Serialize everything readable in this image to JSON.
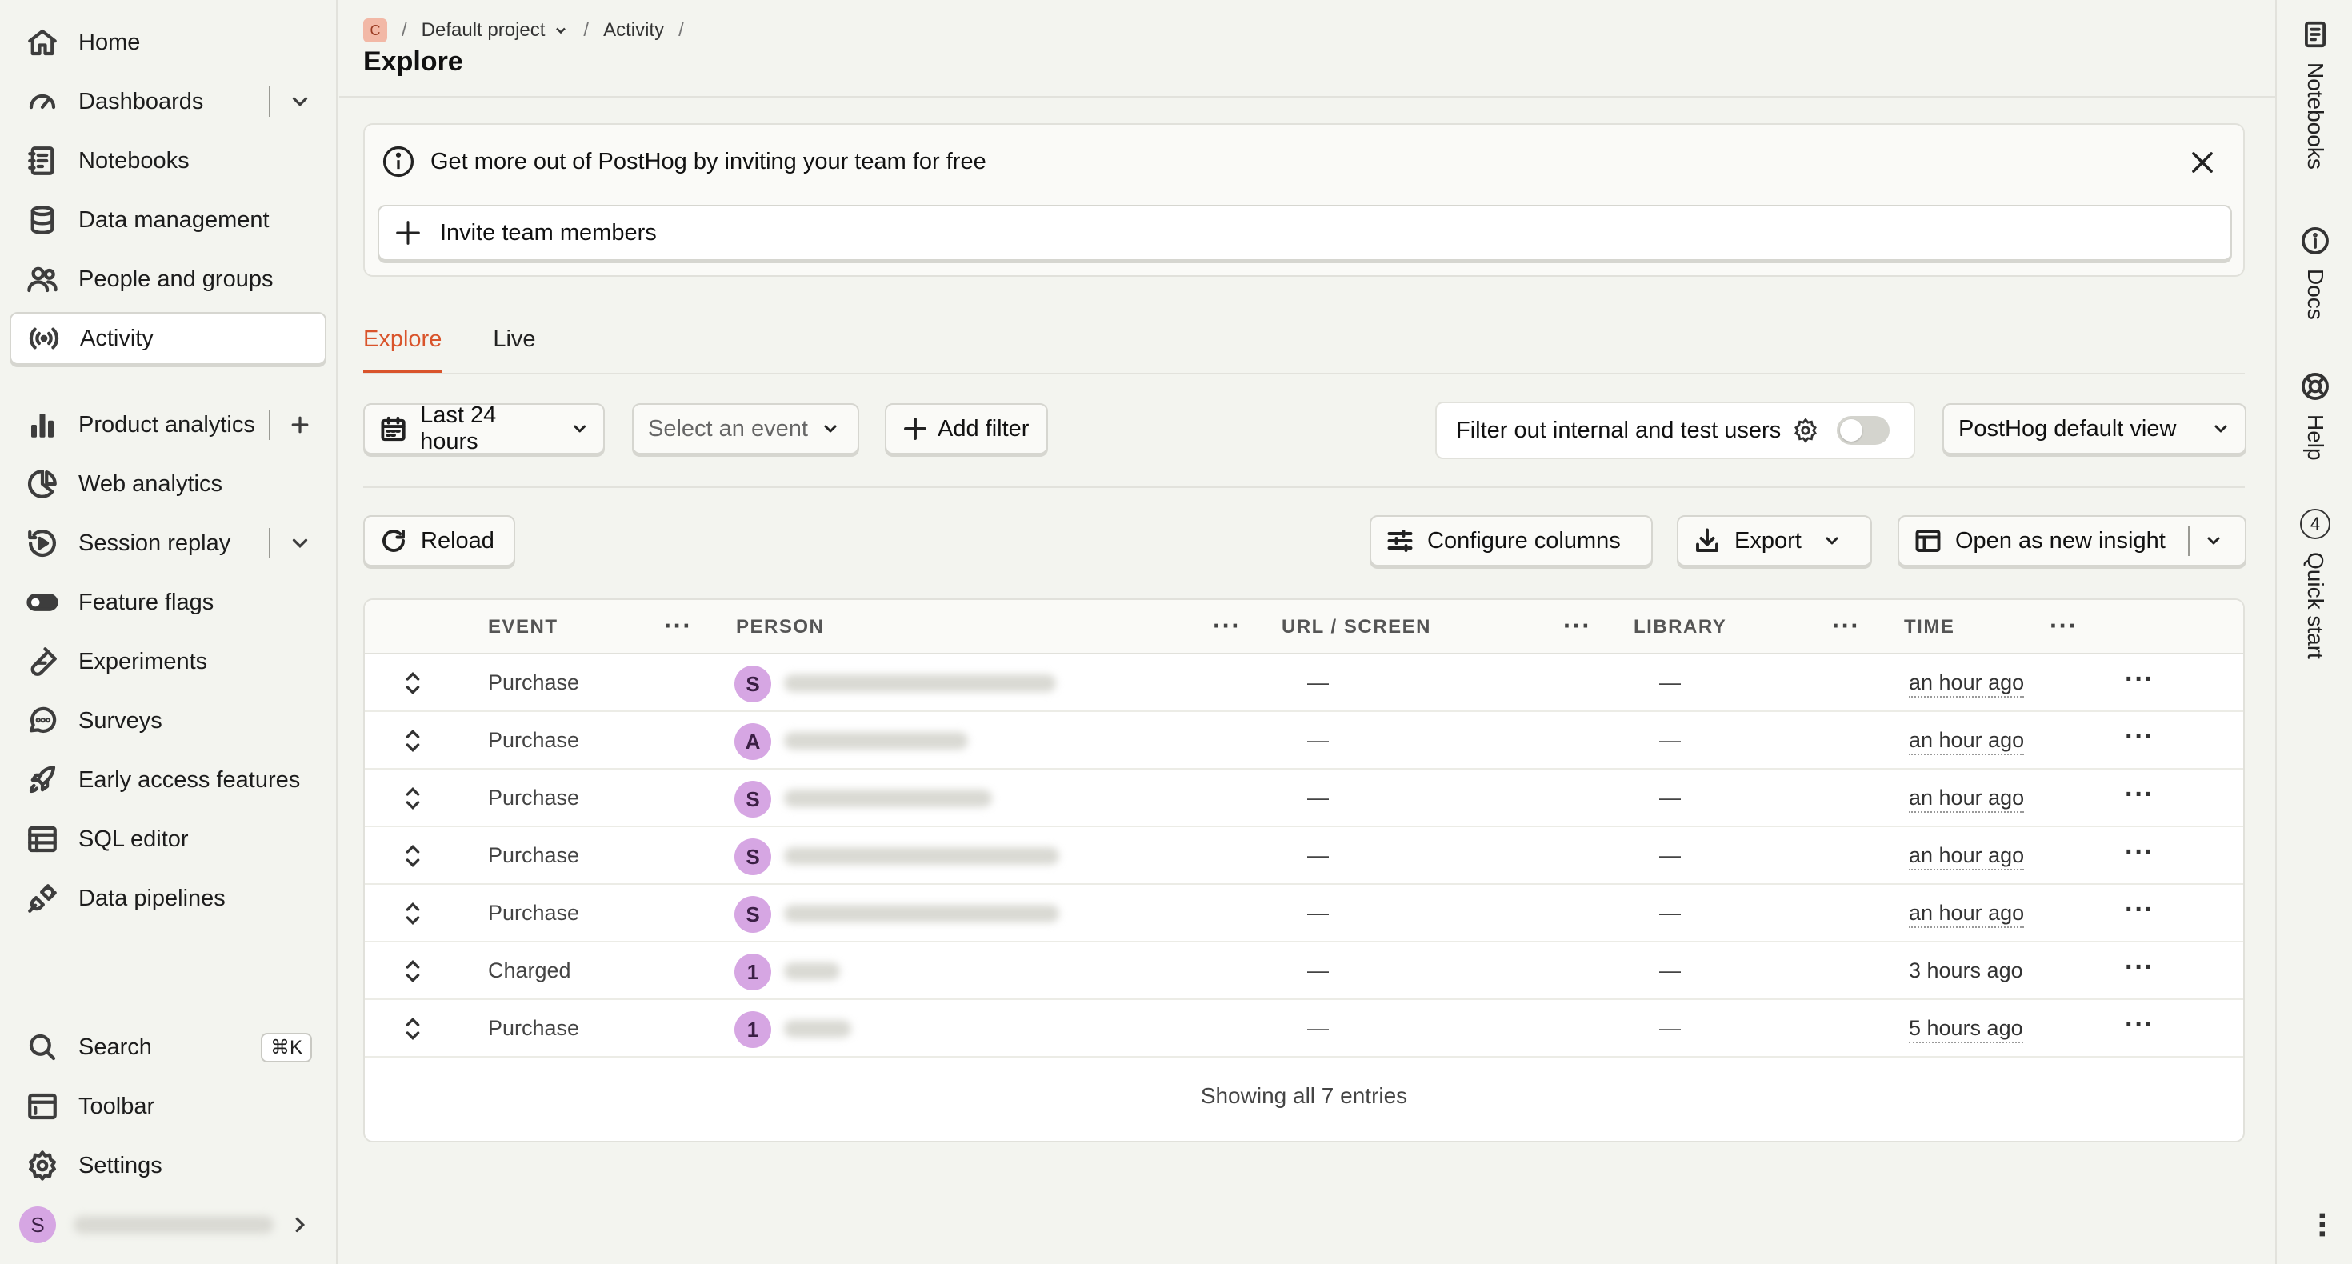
{
  "sidebar": {
    "items": [
      {
        "label": "Home"
      },
      {
        "label": "Dashboards"
      },
      {
        "label": "Notebooks"
      },
      {
        "label": "Data management"
      },
      {
        "label": "People and groups"
      },
      {
        "label": "Activity"
      },
      {
        "label": "Product analytics"
      },
      {
        "label": "Web analytics"
      },
      {
        "label": "Session replay"
      },
      {
        "label": "Feature flags"
      },
      {
        "label": "Experiments"
      },
      {
        "label": "Surveys"
      },
      {
        "label": "Early access features"
      },
      {
        "label": "SQL editor"
      },
      {
        "label": "Data pipelines"
      }
    ],
    "bottom": {
      "search": "Search",
      "search_shortcut": "⌘K",
      "toolbar": "Toolbar",
      "settings": "Settings",
      "user_initial": "S"
    }
  },
  "breadcrumb": {
    "project_initial": "C",
    "project": "Default project",
    "section": "Activity",
    "sep": "/"
  },
  "page": {
    "title": "Explore"
  },
  "banner": {
    "text": "Get more out of PostHog by inviting your team for free",
    "invite_label": "Invite team members"
  },
  "tabs": [
    {
      "label": "Explore"
    },
    {
      "label": "Live"
    }
  ],
  "filters": {
    "date_range": "Last 24 hours",
    "event_placeholder": "Select an event",
    "add_filter": "Add filter",
    "internal_filter": "Filter out internal and test users",
    "view": "PostHog default view"
  },
  "actions": {
    "reload": "Reload",
    "configure_columns": "Configure columns",
    "export": "Export",
    "open_insight": "Open as new insight"
  },
  "table": {
    "columns": [
      "EVENT",
      "PERSON",
      "URL / SCREEN",
      "LIBRARY",
      "TIME"
    ],
    "rows": [
      {
        "event": "Purchase",
        "initial": "S",
        "url": "—",
        "library": "—",
        "time": "an hour ago"
      },
      {
        "event": "Purchase",
        "initial": "A",
        "url": "—",
        "library": "—",
        "time": "an hour ago"
      },
      {
        "event": "Purchase",
        "initial": "S",
        "url": "—",
        "library": "—",
        "time": "an hour ago"
      },
      {
        "event": "Purchase",
        "initial": "S",
        "url": "—",
        "library": "—",
        "time": "an hour ago"
      },
      {
        "event": "Purchase",
        "initial": "S",
        "url": "—",
        "library": "—",
        "time": "an hour ago"
      },
      {
        "event": "Charged",
        "initial": "1",
        "url": "—",
        "library": "—",
        "time": "3 hours ago"
      },
      {
        "event": "Purchase",
        "initial": "1",
        "url": "—",
        "library": "—",
        "time": "5 hours ago"
      }
    ],
    "footer": "Showing all 7 entries"
  },
  "rail": {
    "notebooks": "Notebooks",
    "docs": "Docs",
    "help": "Help",
    "quick_start": "Quick start",
    "quick_start_count": "4"
  },
  "colors": {
    "accent": "#d9542b",
    "avatar": "#d6a6e3",
    "background": "#f3f4ef"
  }
}
